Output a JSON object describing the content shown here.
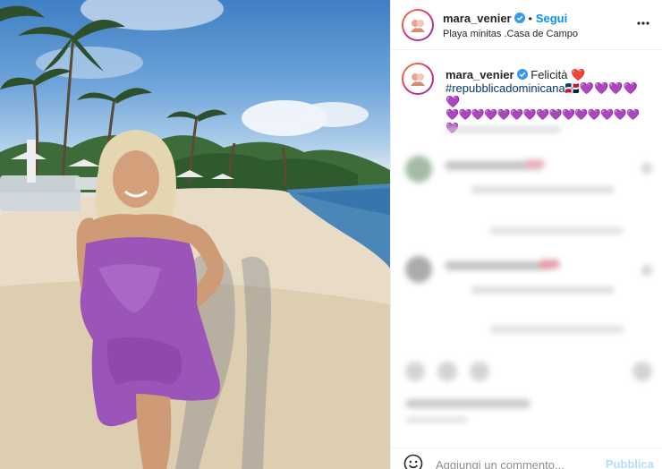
{
  "post": {
    "username": "mara_venier",
    "verified_icon": "verified-badge-icon",
    "separator": "•",
    "follow_label": "Segui",
    "location": "Playa minitas .Casa de Campo",
    "more_icon": "more-options-icon"
  },
  "caption": {
    "username": "mara_venier",
    "text": "Felicità",
    "heart_red": "❤️",
    "hashtag": "#repubblicadominicana",
    "flag": "🇩🇴",
    "hearts_line1": "💜💜💜💜💜",
    "hearts_line2": "💜💜💜💜💜💜💜💜💜💜💜💜💜💜💜💜"
  },
  "comment_box": {
    "emoji_icon": "emoji-smile-icon",
    "placeholder": "Aggiungi un commento...",
    "publish_label": "Pubblica"
  },
  "colors": {
    "accent_blue": "#0095f6",
    "publish_disabled": "#b2dffc",
    "text": "#262626",
    "verified_blue": "#3897f0"
  }
}
